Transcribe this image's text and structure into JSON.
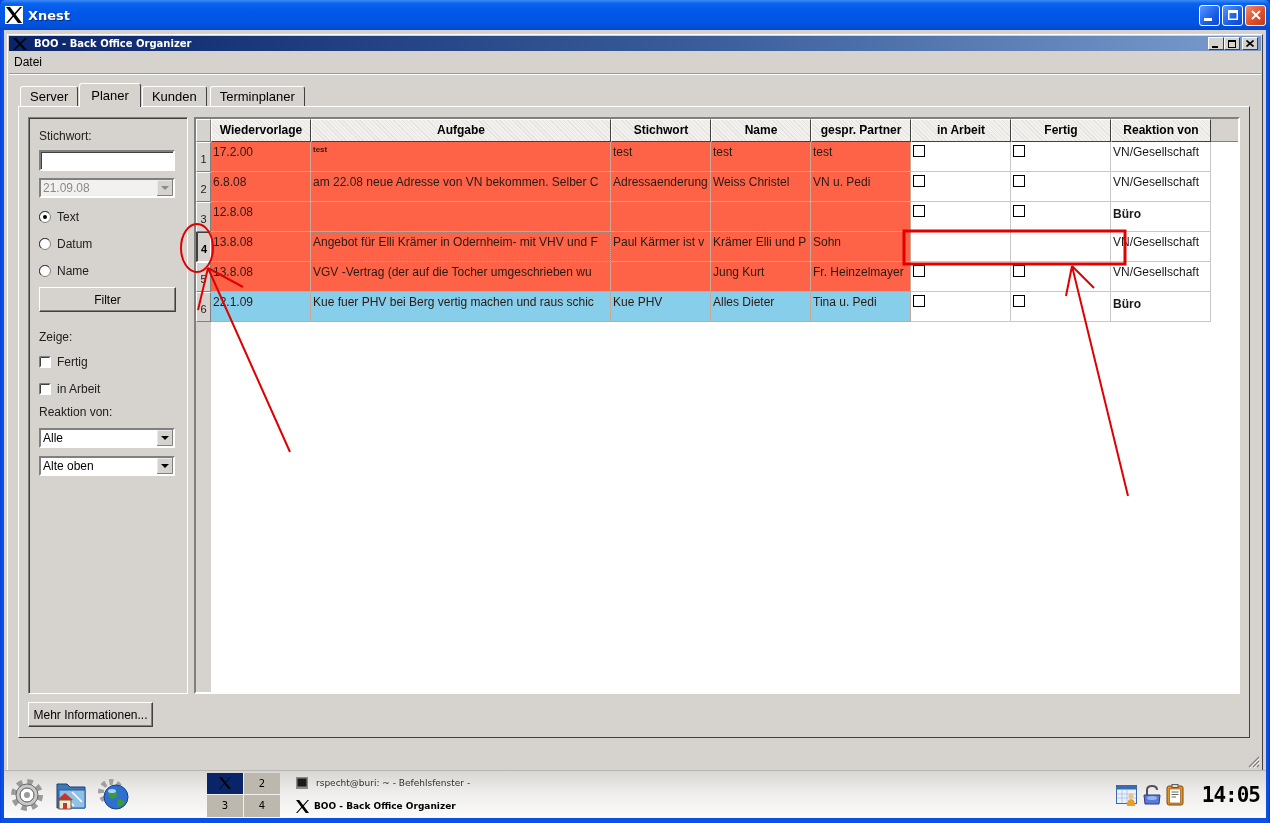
{
  "outer_window": {
    "title": "Xnest"
  },
  "app_window": {
    "title": "BOO - Back Office Organizer"
  },
  "menu": [
    "Datei"
  ],
  "tabs": [
    {
      "label": "Server",
      "selected": false
    },
    {
      "label": "Planer",
      "selected": true
    },
    {
      "label": "Kunden",
      "selected": false
    },
    {
      "label": "Terminplaner",
      "selected": false
    }
  ],
  "filter_panel": {
    "keyword_label": "Stichwort:",
    "date_field": {
      "value": "21.09.08",
      "disabled": true
    },
    "search_by": [
      {
        "label": "Text",
        "selected": true
      },
      {
        "label": "Datum",
        "selected": false
      },
      {
        "label": "Name",
        "selected": false
      }
    ],
    "filter_button": "Filter",
    "show_label": "Zeige:",
    "show_options": [
      {
        "label": "Fertig",
        "checked": false
      },
      {
        "label": "in Arbeit",
        "checked": false
      }
    ],
    "reaction_label": "Reaktion von:",
    "reaction_select": {
      "value": "Alle"
    },
    "sort_select": {
      "value": "Alte oben"
    }
  },
  "table": {
    "columns": [
      "Wiedervorlage",
      "Aufgabe",
      "Stichwort",
      "Name",
      "gespr. Partner",
      "in Arbeit",
      "Fertig",
      "Reaktion von"
    ],
    "rows": [
      {
        "number": "1",
        "selected": false,
        "color": "#ff6347",
        "cells": [
          {
            "kind": "text",
            "text": "17.2.00",
            "focused": false
          },
          {
            "kind": "small",
            "text": "test",
            "focused": false
          },
          {
            "kind": "text",
            "text": "test",
            "focused": false
          },
          {
            "kind": "text",
            "text": "test",
            "focused": false
          },
          {
            "kind": "text",
            "text": "test",
            "focused": false
          }
        ],
        "in_arbeit": {
          "checked": false
        },
        "fertig": {
          "checked": false
        },
        "reaktion_von": {
          "text": "VN/Gesellschaft",
          "bold": false
        }
      },
      {
        "number": "2",
        "selected": false,
        "color": "#ff6347",
        "cells": [
          {
            "kind": "text",
            "text": "6.8.08",
            "focused": false
          },
          {
            "kind": "text",
            "text": "am 22.08 neue Adresse von VN bekommen. Selber C",
            "focused": false
          },
          {
            "kind": "text",
            "text": "Adressaenderung",
            "focused": false
          },
          {
            "kind": "text",
            "text": "Weiss Christel",
            "focused": false
          },
          {
            "kind": "text",
            "text": "VN u. Pedi",
            "focused": false
          }
        ],
        "in_arbeit": {
          "checked": false
        },
        "fertig": {
          "checked": false
        },
        "reaktion_von": {
          "text": "VN/Gesellschaft",
          "bold": false
        }
      },
      {
        "number": "3",
        "selected": false,
        "color": "#ff6347",
        "cells": [
          {
            "kind": "text",
            "text": "12.8.08",
            "focused": false
          },
          {
            "kind": "text",
            "focused": false
          },
          {
            "kind": "text",
            "focused": false
          },
          {
            "kind": "text",
            "focused": false
          },
          {
            "kind": "text",
            "focused": false
          }
        ],
        "in_arbeit": {
          "checked": false
        },
        "fertig": {
          "checked": false
        },
        "reaktion_von": {
          "text": "Büro",
          "bold": true
        }
      },
      {
        "number": "4",
        "selected": true,
        "color": "#ff6347",
        "cells": [
          {
            "kind": "text",
            "text": "13.8.08",
            "focused": false
          },
          {
            "kind": "text",
            "text": "Angebot für Elli Krämer in Odernheim- mit VHV und F",
            "focused": true
          },
          {
            "kind": "text",
            "text": "Paul Kärmer ist v",
            "focused": false
          },
          {
            "kind": "text",
            "text": "Krämer Elli und P",
            "focused": false
          },
          {
            "kind": "text",
            "text": "Sohn",
            "focused": false
          }
        ],
        "reaktion_von": {
          "text": "VN/Gesellschaft",
          "bold": false
        }
      },
      {
        "number": "5",
        "selected": false,
        "color": "#ff6347",
        "cells": [
          {
            "kind": "text",
            "text": "13.8.08",
            "focused": false
          },
          {
            "kind": "text",
            "text": "VGV -Vertrag (der auf die Tocher umgeschrieben wu",
            "focused": false
          },
          {
            "kind": "text",
            "focused": false
          },
          {
            "kind": "text",
            "text": "Jung Kurt",
            "focused": false
          },
          {
            "kind": "text",
            "text": "Fr. Heinzelmayer",
            "focused": false
          }
        ],
        "in_arbeit": {
          "checked": false
        },
        "fertig": {
          "checked": false
        },
        "reaktion_von": {
          "text": "VN/Gesellschaft",
          "bold": false
        }
      },
      {
        "number": "6",
        "selected": false,
        "color": "#87ceeb",
        "cells": [
          {
            "kind": "text",
            "text": "22.1.09",
            "focused": false
          },
          {
            "kind": "text",
            "text": "Kue fuer PHV bei Berg vertig machen und raus schic",
            "focused": false
          },
          {
            "kind": "text",
            "text": "Kue PHV",
            "focused": false
          },
          {
            "kind": "text",
            "text": "Alles Dieter",
            "focused": false
          },
          {
            "kind": "text",
            "text": "Tina u. Pedi",
            "focused": false
          }
        ],
        "in_arbeit": {
          "checked": false
        },
        "fertig": {
          "checked": false
        },
        "reaktion_von": {
          "text": "Büro",
          "bold": true
        }
      }
    ]
  },
  "more_info_button": "Mehr Informationen...",
  "taskbar": {
    "pager": [
      {
        "selected": true
      },
      {
        "label": "2",
        "selected": false
      },
      {
        "label": "3",
        "selected": false
      },
      {
        "label": "4",
        "selected": false
      }
    ],
    "tasks": [
      {
        "kind": "terminal",
        "title": "rspecht@buri: ~ - Befehlsfenster -",
        "active": false
      },
      {
        "kind": "x11",
        "title": "BOO - Back Office Organizer",
        "active": true
      }
    ],
    "clock": "14:05"
  }
}
